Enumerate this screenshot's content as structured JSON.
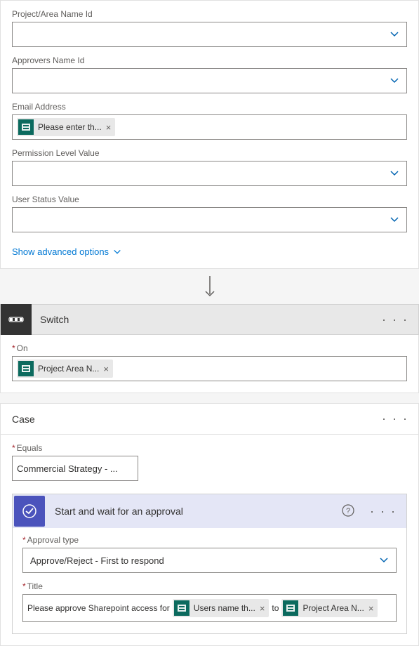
{
  "fields": {
    "project_area_label": "Project/Area Name Id",
    "approvers_label": "Approvers Name Id",
    "email_label": "Email Address",
    "email_token": "Please enter th...",
    "permission_label": "Permission Level Value",
    "user_status_label": "User Status Value"
  },
  "advanced_link": "Show advanced options",
  "switch": {
    "title": "Switch",
    "on_label": "On",
    "on_token": "Project Area N..."
  },
  "case": {
    "title": "Case",
    "equals_label": "Equals",
    "equals_value": "Commercial Strategy - ..."
  },
  "approval": {
    "title": "Start and wait for an approval",
    "type_label": "Approval type",
    "type_value": "Approve/Reject - First to respond",
    "title_field_label": "Title",
    "title_prefix": "Please approve Sharepoint access for",
    "token_users": "Users name th...",
    "title_mid": "to",
    "token_project": "Project Area N..."
  }
}
